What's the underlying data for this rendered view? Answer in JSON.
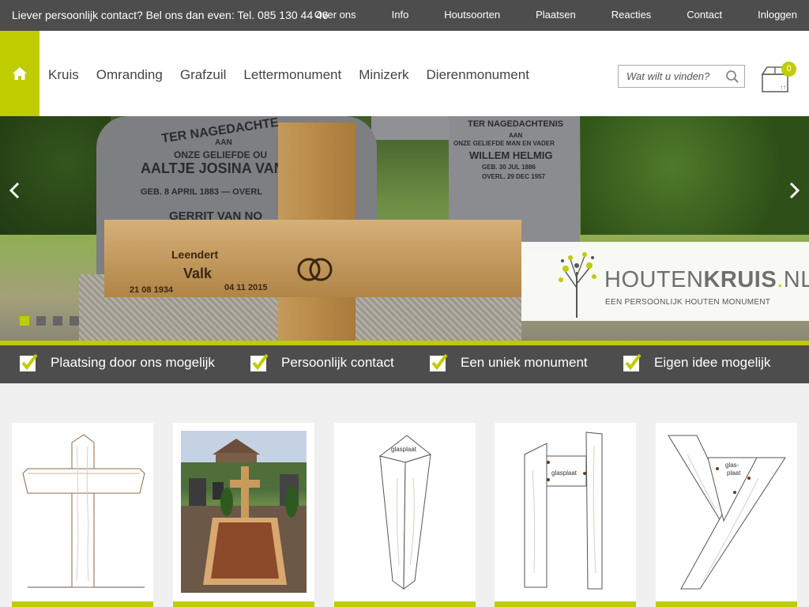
{
  "topbar": {
    "contact_text": "Liever persoonlijk contact? Bel ons dan even: Tel. 085 130 44 46",
    "links": [
      "Over ons",
      "Info",
      "Houtsoorten",
      "Plaatsen",
      "Reacties",
      "Contact",
      "Inloggen"
    ]
  },
  "header": {
    "nav": [
      "Kruis",
      "Omranding",
      "Grafzuil",
      "Lettermonument",
      "Minizerk",
      "Dierenmonument"
    ],
    "search_placeholder": "Wat wilt u vinden?",
    "cart_count": "0"
  },
  "hero": {
    "stone_left_lines": [
      "TER NAGEDACHTE",
      "AAN",
      "ONZE GELIEFDE OU",
      "AALTJE JOSINA VAN",
      "GEB. 8 APRIL 1883 — OVERL",
      "GERRIT VAN NO"
    ],
    "stone_right_lines": [
      "TER NAGEDACHTENIS",
      "AAN",
      "ONZE GELIEFDE MAN EN VADER",
      "WILLEM HELMIG",
      "GEB. 30 JUL 1886",
      "OVERL. 29 DEC 1957"
    ],
    "cross_first_name": "Leendert",
    "cross_last_name": "Valk",
    "cross_birth": "21 08 1934",
    "cross_death": "04 11 2015",
    "logo_name_a": "HOUTEN",
    "logo_name_b": "KRUIS",
    "logo_dot": ".",
    "logo_name_c": "NL",
    "logo_tagline": "EEN PERSOONLIJK HOUTEN MONUMENT",
    "active_slide": 1,
    "slide_count": 4
  },
  "usps": [
    "Plaatsing door ons mogelijk",
    "Persoonlijk contact",
    "Een uniek monument",
    "Eigen idee mogelijk"
  ],
  "products": {
    "glass_label": "glasplaat",
    "glass_label_split": [
      "glas-",
      "plaat"
    ]
  },
  "colors": {
    "accent": "#bfcc00",
    "dark": "#4d4d4d",
    "text": "#444444"
  }
}
